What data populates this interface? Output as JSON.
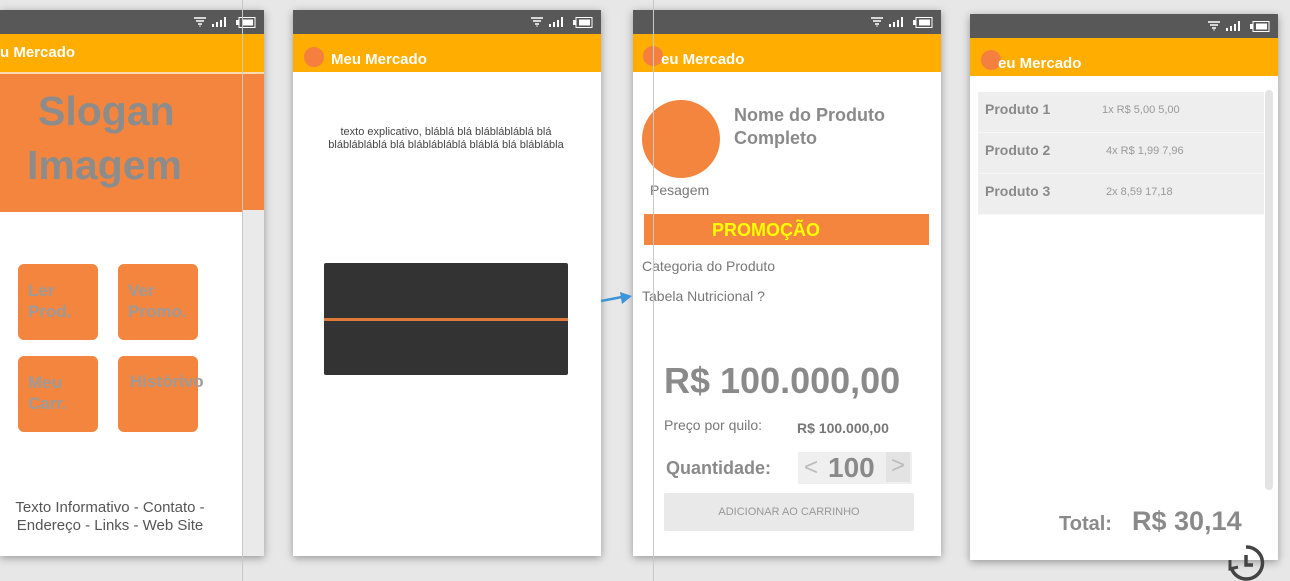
{
  "screen1": {
    "app_title": "u Mercado",
    "slogan_line1": "Slogan",
    "slogan_line2": "Imagem",
    "tiles": [
      {
        "line1": "Ler",
        "line2": "Prod."
      },
      {
        "line1": "Ver",
        "line2": "Promo."
      },
      {
        "line1": "Meu",
        "line2": "Carr."
      },
      {
        "line1": "Histórivo",
        "line2": ""
      }
    ],
    "footer_line1": "Texto Informativo - Contato -",
    "footer_line2": "Endereço - Links - Web Site"
  },
  "screen2": {
    "app_title": "Meu Mercado",
    "explanation": "texto explicativo, bláblá blá bláblábláblá blá bláblábláblá blá bláblábláblá bláblá blá bláblábla"
  },
  "screen3": {
    "app_title": "eu Mercado",
    "product_name": "Nome do Produto Completo",
    "weighing": "Pesagem",
    "promo": "PROMOÇÃO",
    "category": "Categoria do Produto",
    "nutrition": "Tabela Nutricional ?",
    "price": "R$ 100.000,00",
    "price_per_kg_label": "Preço por quilo:",
    "price_per_kg_value": "R$ 100.000,00",
    "quantity_label": "Quantidade:",
    "quantity_value": "100",
    "decrement": "<",
    "increment": ">",
    "add_to_cart": "ADICIONAR AO CARRINHO"
  },
  "screen4": {
    "app_title": "eu Mercado",
    "items": [
      {
        "name": "Produto 1",
        "detail": "1x R$ 5,00 5,00"
      },
      {
        "name": "Produto 2",
        "detail": "4x R$ 1,99 7,96"
      },
      {
        "name": "Produto 3",
        "detail": "2x 8,59 17,18"
      }
    ],
    "total_label": "Total:",
    "total_value": "R$ 30,14"
  },
  "icons": {
    "status": [
      "wifi-icon",
      "signal-icon",
      "battery-icon"
    ],
    "history": "history-icon",
    "arrow": "arrow-right-icon"
  },
  "colors": {
    "app_bar": "#ffad00",
    "accent_orange": "#f4853f",
    "status_bar": "#585858",
    "promo_text": "#ffff00",
    "scanner_bg": "#333333"
  }
}
